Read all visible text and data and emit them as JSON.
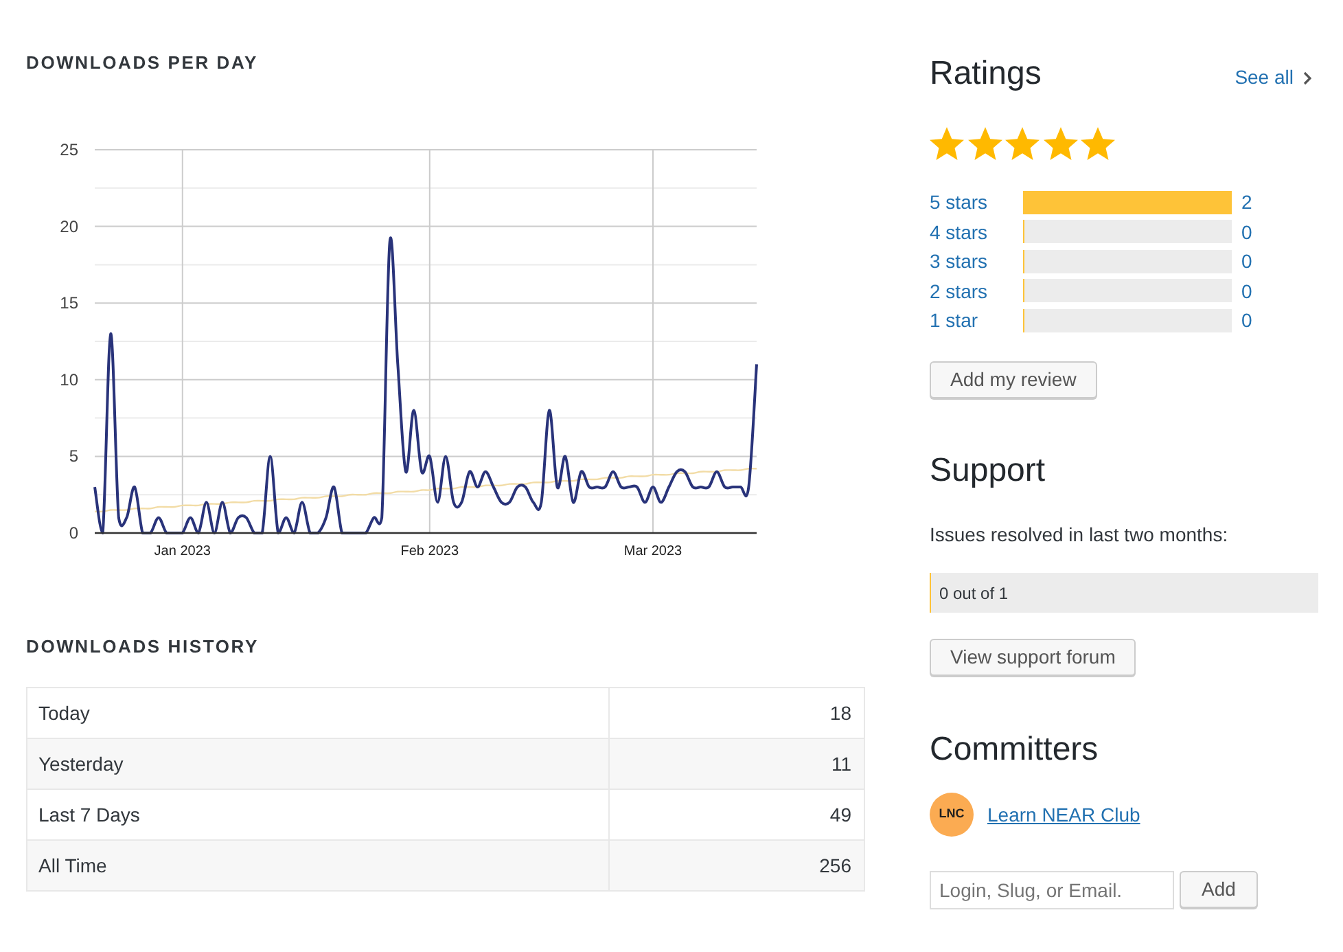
{
  "downloads_per_day": {
    "chart_data": {
      "type": "line",
      "title": "DOWNLOADS PER DAY",
      "x": [
        "2022-12-21",
        "2022-12-22",
        "2022-12-23",
        "2022-12-24",
        "2022-12-25",
        "2022-12-26",
        "2022-12-27",
        "2022-12-28",
        "2022-12-29",
        "2022-12-30",
        "2022-12-31",
        "2023-01-01",
        "2023-01-02",
        "2023-01-03",
        "2023-01-04",
        "2023-01-05",
        "2023-01-06",
        "2023-01-07",
        "2023-01-08",
        "2023-01-09",
        "2023-01-10",
        "2023-01-11",
        "2023-01-12",
        "2023-01-13",
        "2023-01-14",
        "2023-01-15",
        "2023-01-16",
        "2023-01-17",
        "2023-01-18",
        "2023-01-19",
        "2023-01-20",
        "2023-01-21",
        "2023-01-22",
        "2023-01-23",
        "2023-01-24",
        "2023-01-25",
        "2023-01-26",
        "2023-01-27",
        "2023-01-28",
        "2023-01-29",
        "2023-01-30",
        "2023-01-31",
        "2023-02-01",
        "2023-02-02",
        "2023-02-03",
        "2023-02-04",
        "2023-02-05",
        "2023-02-06",
        "2023-02-07",
        "2023-02-08",
        "2023-02-09",
        "2023-02-10",
        "2023-02-11",
        "2023-02-12",
        "2023-02-13",
        "2023-02-14",
        "2023-02-15",
        "2023-02-16",
        "2023-02-17",
        "2023-02-18",
        "2023-02-19",
        "2023-02-20",
        "2023-02-21",
        "2023-02-22",
        "2023-02-23",
        "2023-02-24",
        "2023-02-25",
        "2023-02-26",
        "2023-02-27",
        "2023-02-28",
        "2023-03-01",
        "2023-03-02",
        "2023-03-03",
        "2023-03-04",
        "2023-03-05",
        "2023-03-06",
        "2023-03-07",
        "2023-03-08",
        "2023-03-09",
        "2023-03-10",
        "2023-03-11",
        "2023-03-12",
        "2023-03-13",
        "2023-03-14"
      ],
      "series": [
        {
          "color": "#29337a",
          "values": [
            3,
            0,
            13,
            1,
            1,
            3,
            0,
            0,
            1,
            0,
            0,
            0,
            1,
            0,
            2,
            0,
            2,
            0,
            1,
            1,
            0,
            0,
            5,
            0,
            1,
            0,
            2,
            0,
            0,
            1,
            3,
            0,
            0,
            0,
            0,
            1,
            1,
            19,
            11,
            4,
            8,
            4,
            5,
            2,
            5,
            2,
            2,
            4,
            3,
            4,
            3,
            2,
            2,
            3,
            3,
            2,
            2,
            8,
            3,
            5,
            2,
            4,
            3,
            3,
            3,
            4,
            3,
            3,
            3,
            2,
            3,
            2,
            3,
            4,
            4,
            3,
            3,
            3,
            4,
            3,
            3,
            3,
            3,
            11
          ]
        },
        {
          "color": "#f2dca6",
          "values": [
            1.4,
            1.4,
            1.5,
            1.5,
            1.5,
            1.6,
            1.6,
            1.6,
            1.7,
            1.7,
            1.7,
            1.8,
            1.8,
            1.8,
            1.9,
            1.9,
            1.9,
            2.0,
            2.0,
            2.0,
            2.1,
            2.1,
            2.1,
            2.2,
            2.2,
            2.2,
            2.3,
            2.3,
            2.3,
            2.4,
            2.4,
            2.4,
            2.5,
            2.5,
            2.5,
            2.6,
            2.6,
            2.6,
            2.7,
            2.7,
            2.7,
            2.8,
            2.8,
            2.9,
            2.9,
            2.9,
            3.0,
            3.0,
            3.0,
            3.1,
            3.1,
            3.1,
            3.2,
            3.2,
            3.2,
            3.3,
            3.3,
            3.3,
            3.4,
            3.4,
            3.4,
            3.5,
            3.5,
            3.5,
            3.6,
            3.6,
            3.6,
            3.7,
            3.7,
            3.7,
            3.8,
            3.8,
            3.8,
            3.9,
            3.9,
            3.9,
            4.0,
            4.0,
            4.0,
            4.1,
            4.1,
            4.1,
            4.2,
            4.2
          ]
        }
      ],
      "xlim": [
        "2022-12-21",
        "2023-03-14"
      ],
      "ylim": [
        0,
        25
      ],
      "yticks": [
        0,
        5,
        10,
        15,
        20,
        25
      ],
      "xticks": [
        {
          "value": "2023-01-01",
          "label": "Jan 2023"
        },
        {
          "value": "2023-02-01",
          "label": "Feb 2023"
        },
        {
          "value": "2023-03-01",
          "label": "Mar 2023"
        }
      ],
      "grid": true
    }
  },
  "downloads_history": {
    "title": "DOWNLOADS HISTORY",
    "rows": [
      {
        "label": "Today",
        "value": "18"
      },
      {
        "label": "Yesterday",
        "value": "11"
      },
      {
        "label": "Last 7 Days",
        "value": "49"
      },
      {
        "label": "All Time",
        "value": "256"
      }
    ]
  },
  "ratings": {
    "title": "Ratings",
    "see_all": "See all",
    "stars": 5,
    "rows": [
      {
        "label": "5 stars",
        "level": 1,
        "count": "2"
      },
      {
        "label": "4 stars",
        "level": 0,
        "count": "0"
      },
      {
        "label": "3 stars",
        "level": 0,
        "count": "0"
      },
      {
        "label": "2 stars",
        "level": 0,
        "count": "0"
      },
      {
        "label": "1 star",
        "level": 0,
        "count": "0"
      }
    ],
    "button": "Add my review"
  },
  "support": {
    "title": "Support",
    "caption": "Issues resolved in last two months:",
    "resolved": {
      "text": "0 out of 1",
      "level": 0
    },
    "button": "View support forum"
  },
  "committers": {
    "title": "Committers",
    "people": [
      {
        "avatar_text": "LNC",
        "name": "Learn NEAR Club"
      }
    ],
    "add_field": {
      "placeholder": "Login, Slug, or Email."
    },
    "add_button": "Add"
  }
}
